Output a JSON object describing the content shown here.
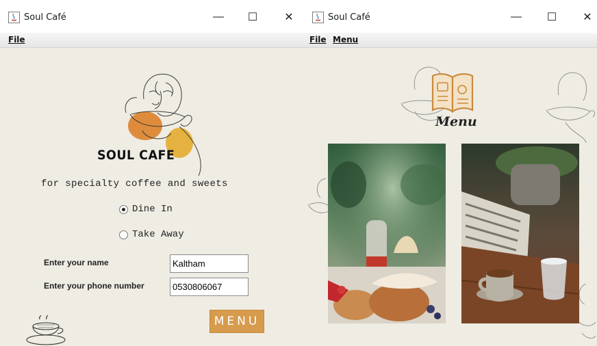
{
  "left_window": {
    "title": "Soul Café",
    "menubar": [
      {
        "label": "File"
      }
    ],
    "brand": "SOUL CAFE",
    "tagline": "for specialty coffee and sweets",
    "options": [
      {
        "label": "Dine In",
        "selected": true
      },
      {
        "label": "Take Away",
        "selected": false
      }
    ],
    "name_label": "Enter your name",
    "name_value": "Kaltham",
    "phone_label": "Enter your phone number",
    "phone_value": "0530806067",
    "menu_button": "MENU"
  },
  "right_window": {
    "title": "Soul Café",
    "menubar": [
      {
        "label": "File"
      },
      {
        "label": "Menu"
      }
    ],
    "heading": "Menu",
    "photos": [
      "pancakes-dessert-photo",
      "coffee-and-newspaper-photo"
    ]
  },
  "window_controls": {
    "minimize": "—",
    "maximize": "☐",
    "close": "✕"
  },
  "colors": {
    "background": "#efece4",
    "accent": "#d69b4d",
    "orange_blob": "#de8c3c",
    "yellow_blob": "#e5b241"
  }
}
